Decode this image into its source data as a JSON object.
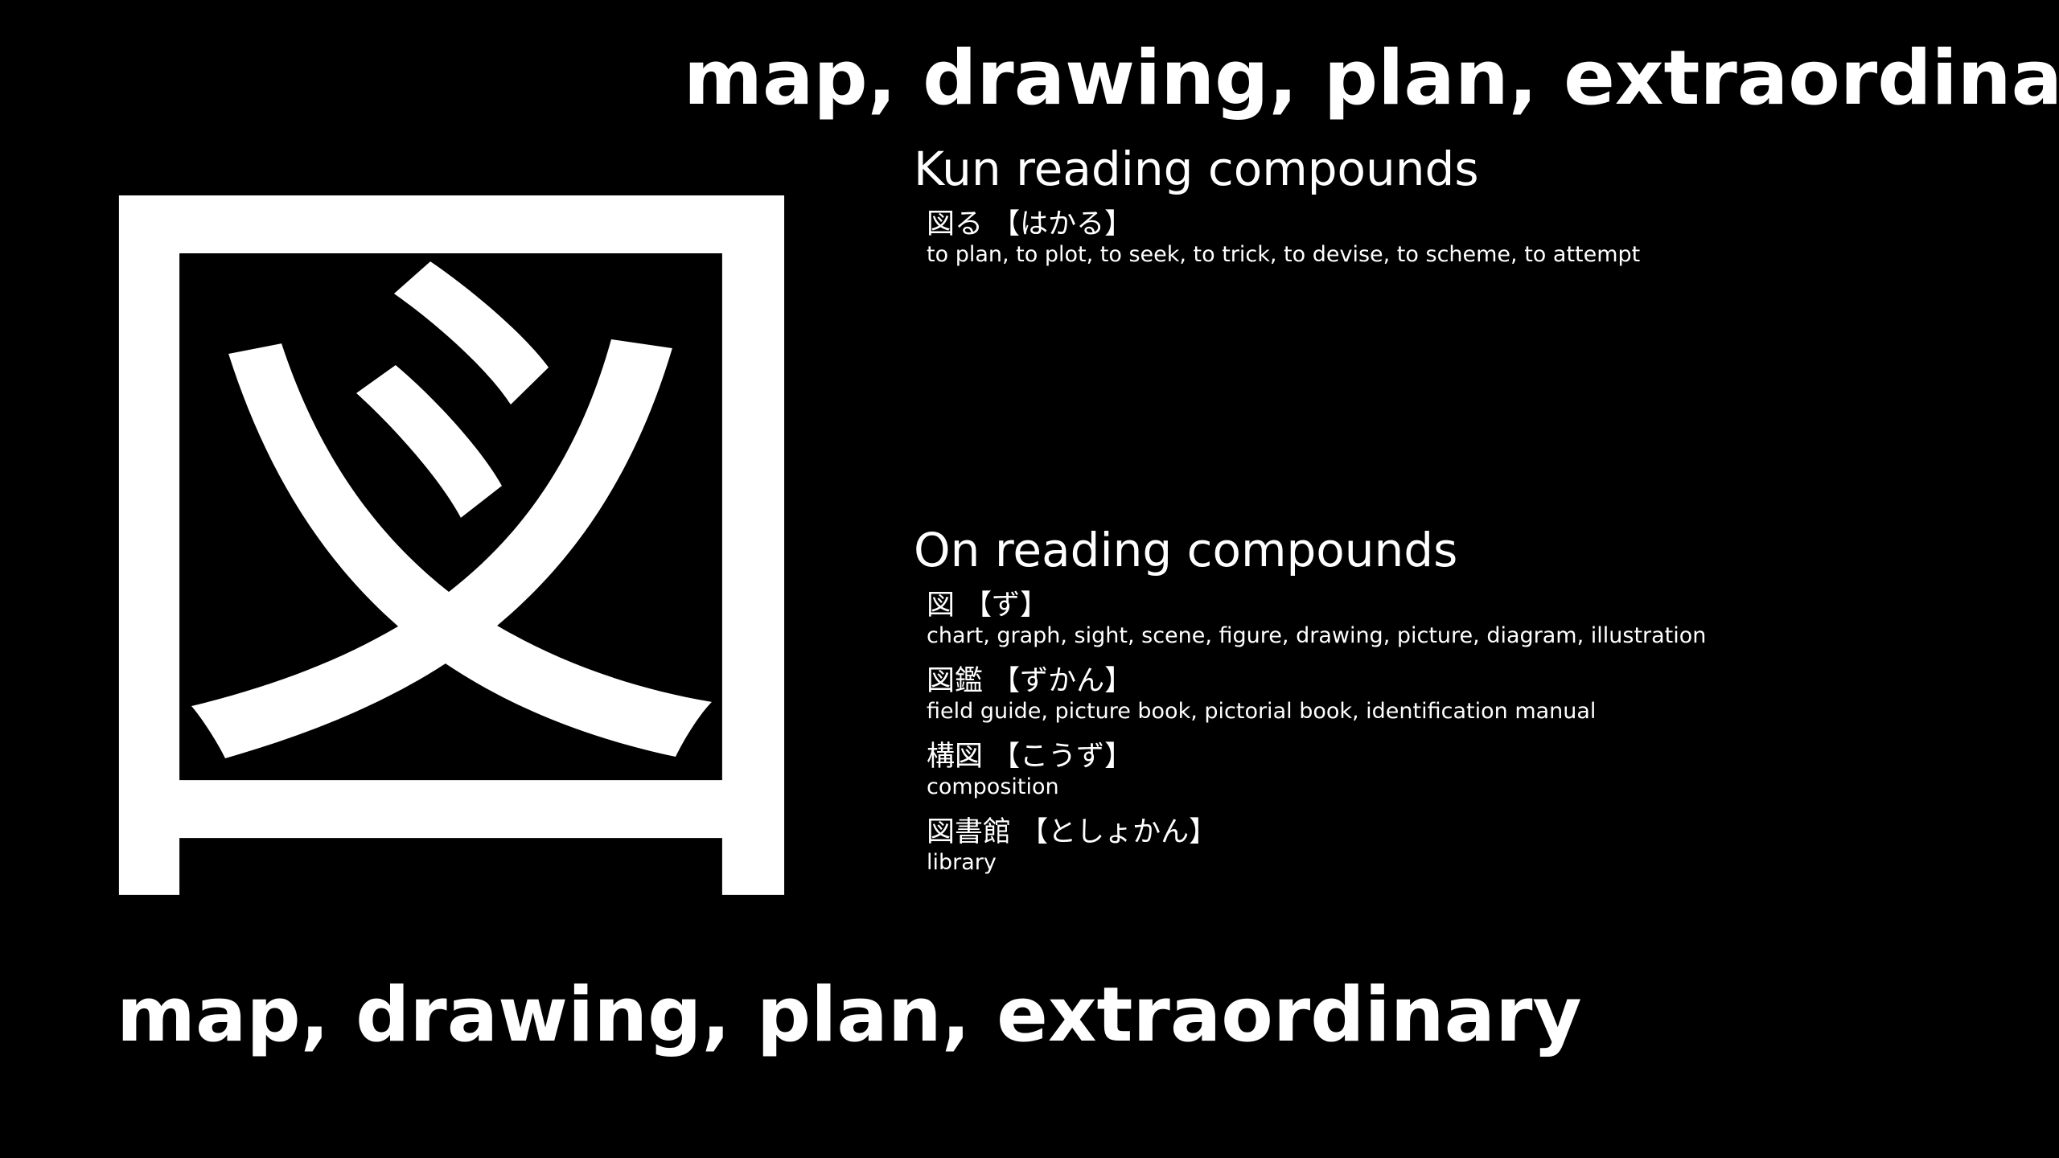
{
  "kanji": {
    "character": "図",
    "meaning": "map, drawing, plan, extraordinary"
  },
  "kun_section": {
    "heading": "Kun reading compounds",
    "compounds": [
      {
        "word": "図る 【はかる】",
        "gloss": "to plan, to plot, to seek, to trick, to devise, to scheme, to attempt"
      }
    ]
  },
  "on_section": {
    "heading": "On reading compounds",
    "compounds": [
      {
        "word": "図 【ず】",
        "gloss": "chart, graph, sight, scene, figure, drawing, picture, diagram, illustration"
      },
      {
        "word": "図鑑 【ずかん】",
        "gloss": "field guide, picture book, pictorial book, identification manual"
      },
      {
        "word": "構図 【こうず】",
        "gloss": "composition"
      },
      {
        "word": "図書館 【としょかん】",
        "gloss": "library"
      }
    ]
  },
  "colors": {
    "background": "#000000",
    "text": "#ffffff"
  }
}
